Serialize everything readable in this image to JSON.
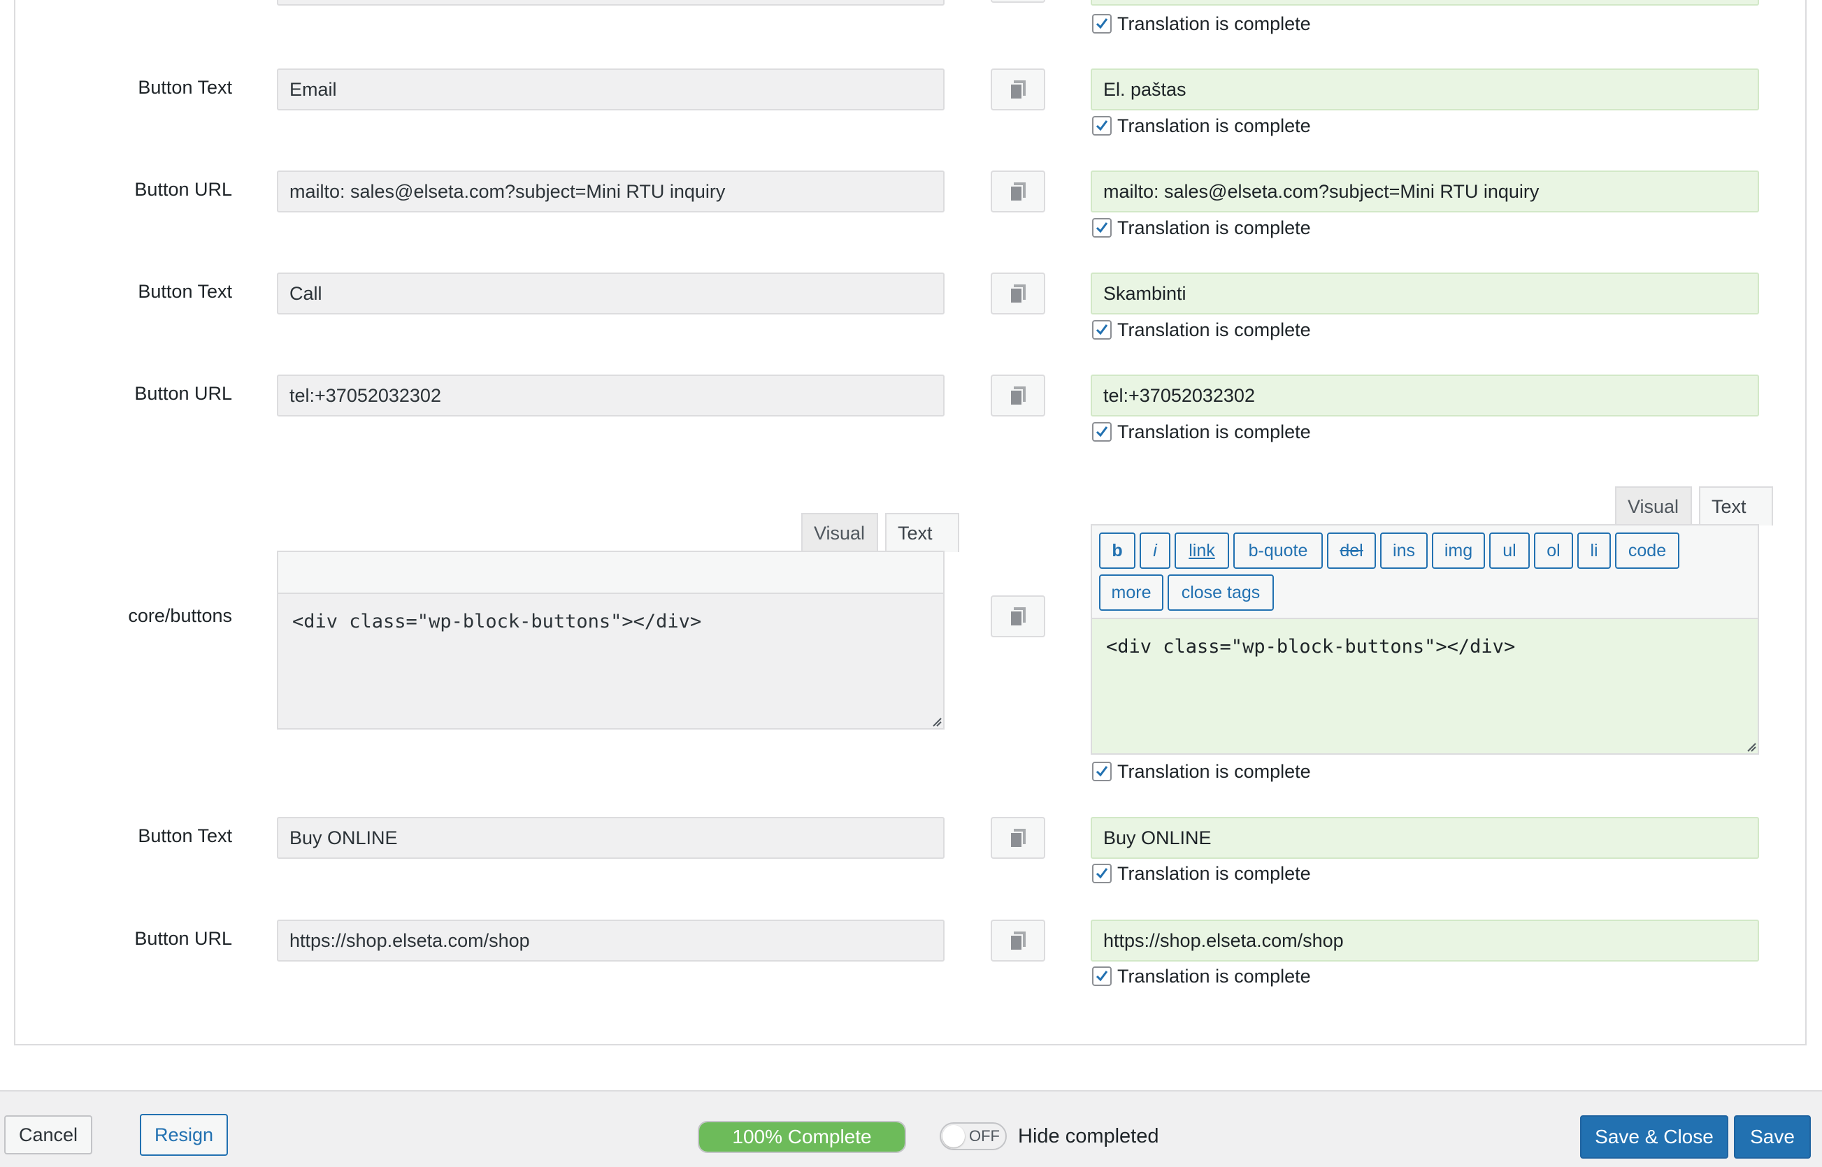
{
  "rows": [
    {
      "label": "Button Text",
      "source": "Email",
      "target": "El. paštas"
    },
    {
      "label": "Button URL",
      "source": "mailto: sales@elseta.com?subject=Mini RTU inquiry",
      "target": "mailto: sales@elseta.com?subject=Mini RTU inquiry"
    },
    {
      "label": "Button Text",
      "source": "Call",
      "target": "Skambinti"
    },
    {
      "label": "Button URL",
      "source": "tel:+37052032302",
      "target": "tel:+37052032302"
    },
    {
      "label": "Button Text",
      "source": "Buy ONLINE",
      "target": "Buy ONLINE"
    },
    {
      "label": "Button URL",
      "source": "https://shop.elseta.com/shop",
      "target": "https://shop.elseta.com/shop"
    }
  ],
  "complete_label": "Translation is complete",
  "block": {
    "label": "core/buttons",
    "source_html": "<div class=\"wp-block-buttons\"></div>",
    "target_html": "<div class=\"wp-block-buttons\"></div>"
  },
  "tabs": {
    "visual": "Visual",
    "text": "Text"
  },
  "quicktags": [
    "b",
    "i",
    "link",
    "b-quote",
    "del",
    "ins",
    "img",
    "ul",
    "ol",
    "li",
    "code",
    "more",
    "close tags"
  ],
  "footer": {
    "cancel": "Cancel",
    "resign": "Resign",
    "progress": "100% Complete",
    "progress_value": 100,
    "toggle_state": "OFF",
    "hide_completed": "Hide completed",
    "save_close": "Save & Close",
    "save": "Save"
  },
  "colors": {
    "primary": "#2271b1",
    "progress": "#6dbb5a",
    "target_bg": "#e9f5e3",
    "source_bg": "#f0f0f1"
  },
  "icons": {
    "copy": "copy-icon",
    "checkbox": "checkmark-icon"
  }
}
